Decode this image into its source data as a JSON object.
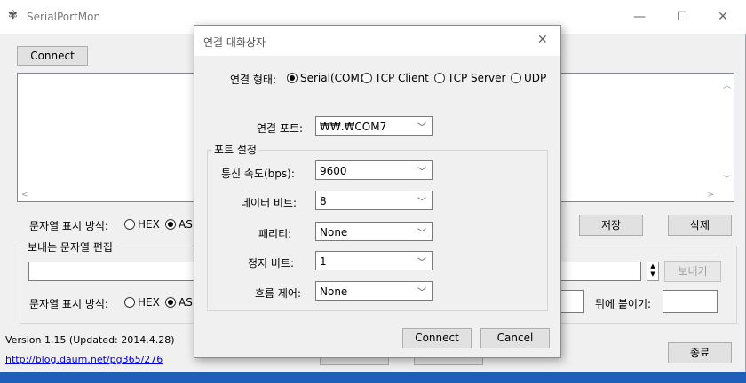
{
  "main": {
    "title": "SerialPortMon",
    "connect_button": "Connect",
    "display_mode_label": "문자열 표시 방식:",
    "hex_label": "HEX",
    "ascii_label_partial": "AS",
    "save_button": "저장",
    "delete_button": "삭제",
    "send_group_label": "보내는 문자열 편집",
    "send_button": "보내기",
    "append_label": "뒤에 붙이기:",
    "version": "Version 1.15 (Updated: 2014.4.28)",
    "link": "http://blog.daum.net/pg365/276",
    "exit_button": "종료"
  },
  "dialog": {
    "title": "연결 대화상자",
    "conn_type_label": "연결 형태:",
    "conn_types": [
      "Serial(COM)",
      "TCP Client",
      "TCP Server",
      "UDP"
    ],
    "selected_conn_type": "Serial(COM)",
    "port_label": "연결 포트:",
    "port_value": "₩₩.₩COM7",
    "port_settings_label": "포트 설정",
    "baud_label": "통신 속도(bps):",
    "baud_value": "9600",
    "databits_label": "데이터 비트:",
    "databits_value": "8",
    "parity_label": "패리티:",
    "parity_value": "None",
    "stopbits_label": "정지 비트:",
    "stopbits_value": "1",
    "flow_label": "흐름 제어:",
    "flow_value": "None",
    "connect_button": "Connect",
    "cancel_button": "Cancel"
  },
  "colors": {
    "accent": "#1f5fb8",
    "link": "#0000ee"
  }
}
